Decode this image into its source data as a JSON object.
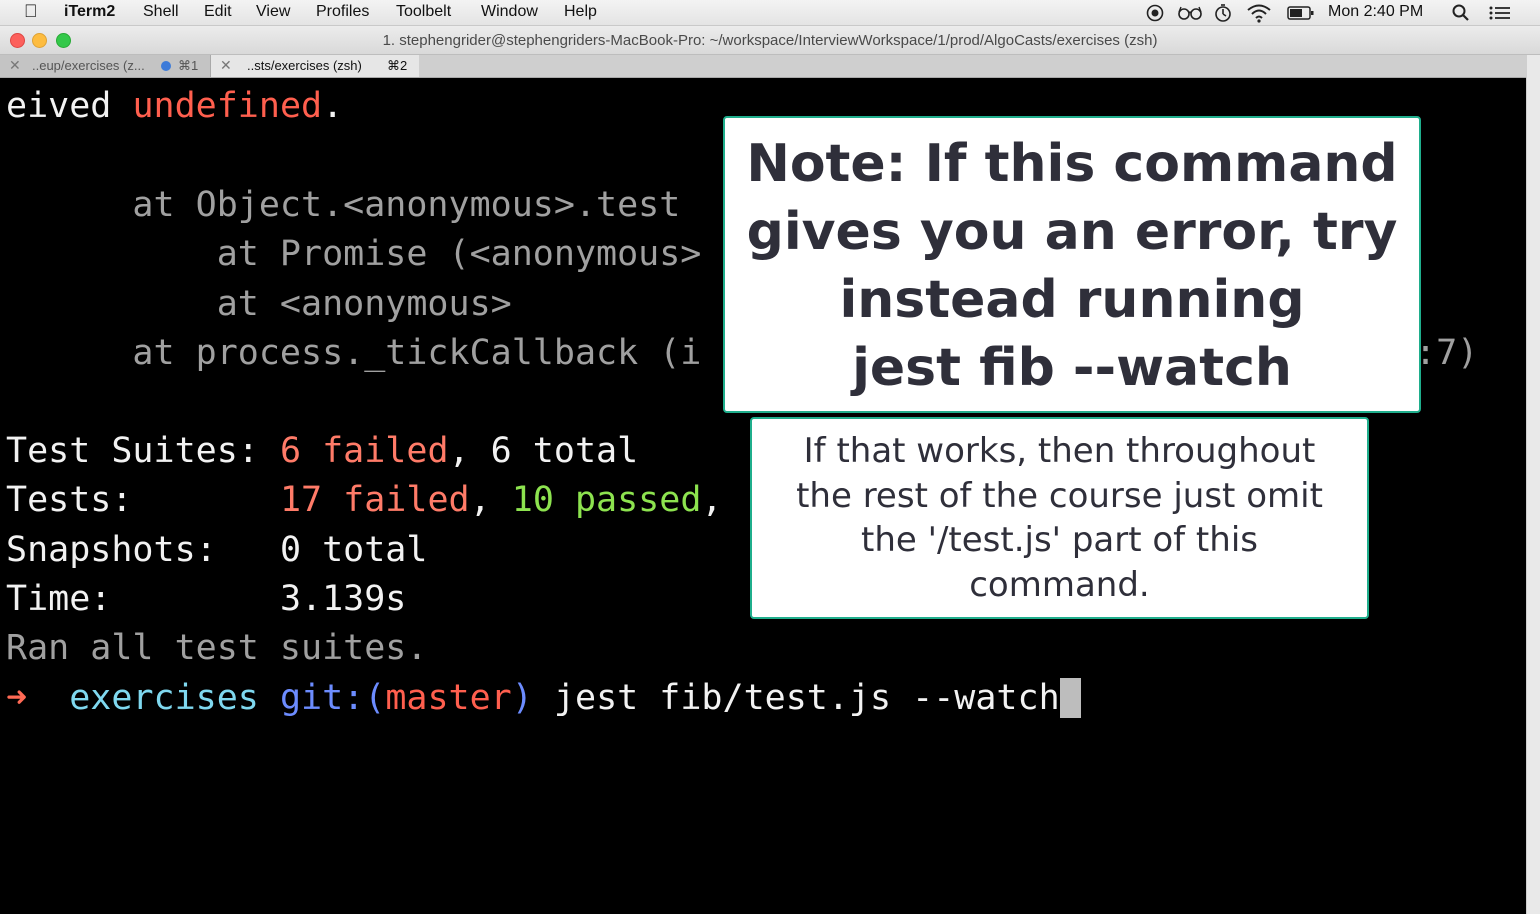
{
  "menubar": {
    "app_name": "iTerm2",
    "items": [
      "Shell",
      "Edit",
      "View",
      "Profiles",
      "Toolbelt",
      "Window",
      "Help"
    ],
    "clock": "Mon 2:40 PM",
    "status_icons": [
      "record-icon",
      "glasses-icon",
      "timer-icon",
      "wifi-icon",
      "battery-icon",
      "spotlight-icon",
      "list-icon"
    ]
  },
  "window": {
    "title": "1. stephengrider@stephengriders-MacBook-Pro: ~/workspace/InterviewWorkspace/1/prod/AlgoCasts/exercises (zsh)"
  },
  "tabs": [
    {
      "label": "..eup/exercises (z...",
      "shortcut": "⌘1",
      "active": false
    },
    {
      "label": "..sts/exercises (zsh)",
      "shortcut": "⌘2",
      "active": true
    }
  ],
  "terminal": {
    "l1_prefix": "eived ",
    "l1_undefined": "undefined",
    "l1_suffix": ".",
    "l3": "      at Object.<anonymous>.test",
    "l4": "          at Promise (<anonymous>",
    "l5": "          at <anonymous>",
    "l6": "      at process._tickCallback (i",
    "l6_tail": ":7)",
    "suites_label": "Test Suites: ",
    "suites_failed": "6 failed",
    "suites_rest": ", 6 total",
    "tests_label": "Tests:       ",
    "tests_failed": "17 failed",
    "tests_comma": ", ",
    "tests_passed": "10 passed",
    "tests_tail": ",",
    "snap_label": "Snapshots:   ",
    "snap_value": "0 total",
    "time_label": "Time:        ",
    "time_value": "3.139s",
    "ran": "Ran all test suites.",
    "prompt_arrow": "➜",
    "prompt_dir": "exercises",
    "prompt_git": "git:(",
    "prompt_branch": "master",
    "prompt_git_close": ")",
    "command": "jest fib/test.js --watch"
  },
  "notes": {
    "main_lines": [
      "Note: If this command",
      "gives you an error, try",
      "instead running",
      "jest fib --watch"
    ],
    "sub_lines": [
      "If that works, then throughout",
      "the rest of the course just omit",
      "the '/test.js' part of this",
      "command."
    ]
  },
  "colors": {
    "terminal_bg": "#000000",
    "error_red": "#ff5f4e",
    "pass_green": "#8de34f",
    "prompt_cyan": "#7fd8ef",
    "git_blue": "#6c8cff",
    "note_border": "#1fae8c"
  }
}
